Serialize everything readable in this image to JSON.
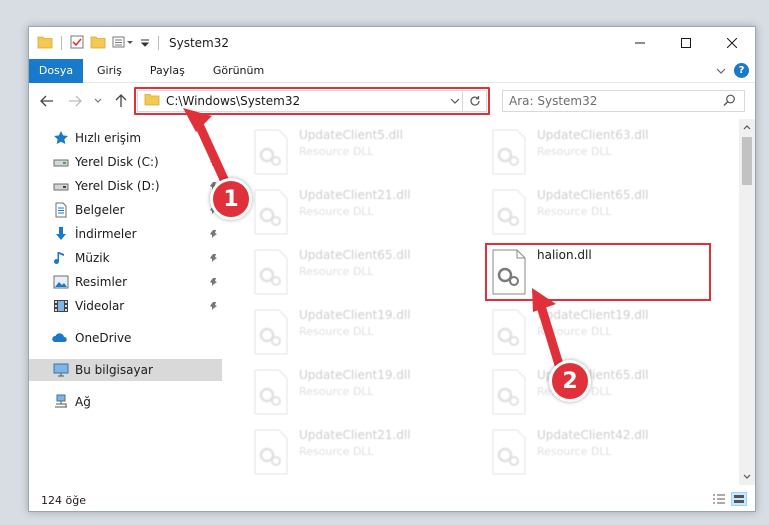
{
  "window": {
    "title": "System32",
    "controls": [
      "minimize",
      "maximize",
      "close"
    ]
  },
  "ribbon": {
    "tabs": [
      {
        "label": "Dosya",
        "active": true
      },
      {
        "label": "Giriş",
        "active": false
      },
      {
        "label": "Paylaş",
        "active": false
      },
      {
        "label": "Görünüm",
        "active": false
      }
    ]
  },
  "address": {
    "path": "C:\\Windows\\System32"
  },
  "search": {
    "placeholder": "Ara: System32"
  },
  "sidebar": {
    "items": [
      {
        "label": "Hızlı erişim",
        "icon": "star-icon",
        "pinned": false
      },
      {
        "label": "Yerel Disk (C:)",
        "icon": "drive-icon",
        "pinned": true
      },
      {
        "label": "Yerel Disk (D:)",
        "icon": "drive-icon",
        "pinned": true
      },
      {
        "label": "Belgeler",
        "icon": "document-icon",
        "pinned": true
      },
      {
        "label": "İndirmeler",
        "icon": "download-icon",
        "pinned": true
      },
      {
        "label": "Müzik",
        "icon": "music-icon",
        "pinned": true
      },
      {
        "label": "Resimler",
        "icon": "pictures-icon",
        "pinned": true
      },
      {
        "label": "Videolar",
        "icon": "video-icon",
        "pinned": true
      },
      {
        "label": "OneDrive",
        "icon": "cloud-icon",
        "pinned": false
      },
      {
        "label": "Bu bilgisayar",
        "icon": "computer-icon",
        "pinned": false,
        "selected": true
      },
      {
        "label": "Ağ",
        "icon": "network-icon",
        "pinned": false
      }
    ]
  },
  "files": {
    "left": [
      {
        "name": "UpdateClient5.dll",
        "type": "Resource DLL"
      },
      {
        "name": "UpdateClient21.dll",
        "type": "Resource DLL"
      },
      {
        "name": "UpdateClient65.dll",
        "type": "Resource DLL"
      },
      {
        "name": "UpdateClient19.dll",
        "type": "Resource DLL"
      },
      {
        "name": "UpdateClient19.dll",
        "type": "Resource DLL"
      },
      {
        "name": "UpdateClient21.dll",
        "type": "Resource DLL"
      }
    ],
    "right": [
      {
        "name": "UpdateClient63.dll",
        "type": "Resource DLL"
      },
      {
        "name": "UpdateClient65.dll",
        "type": "Resource DLL"
      },
      {
        "name": "halion.dll",
        "type": "",
        "highlighted": true
      },
      {
        "name": "UpdateClient19.dll",
        "type": "Resource DLL"
      },
      {
        "name": "UpdateClient65.dll",
        "type": "Resource DLL"
      },
      {
        "name": "UpdateClient42.dll",
        "type": "Resource DLL"
      }
    ]
  },
  "status": {
    "item_count": "124 öğe"
  },
  "annotations": {
    "step1": "1",
    "step2": "2"
  },
  "colors": {
    "accent": "#1979ca",
    "highlight_red": "#e0313a",
    "selected_bg": "#d9d9d9"
  }
}
